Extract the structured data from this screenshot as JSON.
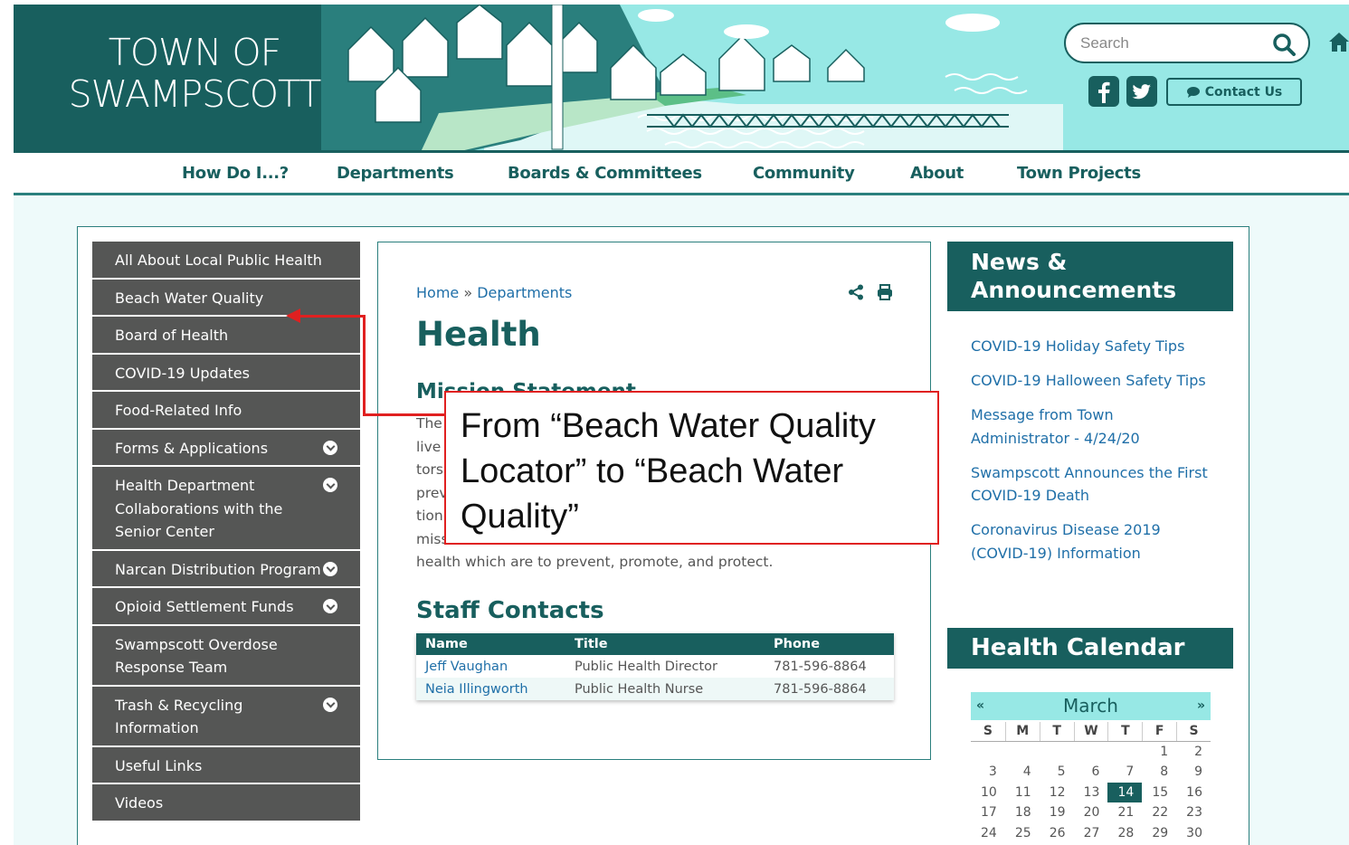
{
  "header": {
    "logo_line1": "TOWN OF",
    "logo_line2": "SWAMPSCOTT",
    "search_placeholder": "Search",
    "contact_label": "Contact Us"
  },
  "nav": {
    "items": [
      "How Do I...?",
      "Departments",
      "Boards & Committees",
      "Community",
      "About",
      "Town Projects"
    ]
  },
  "sidebar": {
    "items": [
      {
        "label": "All About Local Public Health",
        "expandable": false
      },
      {
        "label": "Beach Water Quality",
        "expandable": false
      },
      {
        "label": "Board of Health",
        "expandable": false
      },
      {
        "label": "COVID-19 Updates",
        "expandable": false
      },
      {
        "label": "Food-Related Info",
        "expandable": false
      },
      {
        "label": "Forms & Applications",
        "expandable": true
      },
      {
        "label": "Health Department Collaborations with the Senior Center",
        "expandable": true
      },
      {
        "label": "Narcan Distribution Program",
        "expandable": true
      },
      {
        "label": "Opioid Settlement Funds",
        "expandable": true
      },
      {
        "label": "Swampscott Overdose Response Team",
        "expandable": false
      },
      {
        "label": "Trash & Recycling Information",
        "expandable": true
      },
      {
        "label": "Useful Links",
        "expandable": false
      },
      {
        "label": "Videos",
        "expandable": false
      }
    ]
  },
  "main": {
    "breadcrumb_home": "Home",
    "breadcrumb_sep": "»",
    "breadcrumb_dept": "Departments",
    "title": "Health",
    "mission_heading": "Mission Statement",
    "mission_lines": [
      "The",
      "live",
      "tors",
      "prev",
      "tion",
      "missi",
      "health which are to prevent, promote, and protect."
    ],
    "staff_heading": "Staff Contacts",
    "staff_columns": [
      "Name",
      "Title",
      "Phone"
    ],
    "staff_rows": [
      {
        "name": "Jeff Vaughan",
        "title": "Public Health Director",
        "phone": "781-596-8864"
      },
      {
        "name": "Neia Illingworth",
        "title": "Public Health Nurse",
        "phone": "781-596-8864"
      }
    ]
  },
  "news": {
    "heading": "News & Announcements",
    "items": [
      "COVID-19 Holiday Safety Tips",
      "COVID-19 Halloween Safety Tips",
      "Message from Town Administrator - 4/24/20",
      "Swampscott Announces the First COVID-19 Death",
      "Coronavirus Disease 2019 (COVID-19) Information"
    ]
  },
  "calendar": {
    "heading": "Health Calendar",
    "month": "March",
    "prev": "«",
    "next": "»",
    "day_names": [
      "S",
      "M",
      "T",
      "W",
      "T",
      "F",
      "S"
    ],
    "days": [
      "",
      "",
      "",
      "",
      "",
      "1",
      "2",
      "3",
      "4",
      "5",
      "6",
      "7",
      "8",
      "9",
      "10",
      "11",
      "12",
      "13",
      "14",
      "15",
      "16",
      "17",
      "18",
      "19",
      "20",
      "21",
      "22",
      "23",
      "24",
      "25",
      "26",
      "27",
      "28",
      "29",
      "30"
    ],
    "today": "14"
  },
  "annotation": {
    "text": "From “Beach Water Quality Locator” to “Beach Water Quality”"
  },
  "colors": {
    "brand_dark": "#185f5e",
    "brand_light": "#97e8e5",
    "link": "#1f6fa8",
    "sidebar_bg": "#555655",
    "annotation_red": "#e02020"
  }
}
